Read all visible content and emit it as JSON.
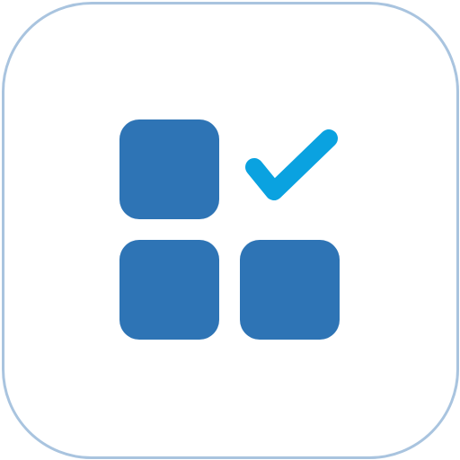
{
  "icon": {
    "name": "app-grid-check-icon",
    "colors": {
      "tile_border": "#a9c4df",
      "tile_background": "#ffffff",
      "squares": "#2e74b5",
      "checkmark": "#0aa2e0"
    }
  }
}
